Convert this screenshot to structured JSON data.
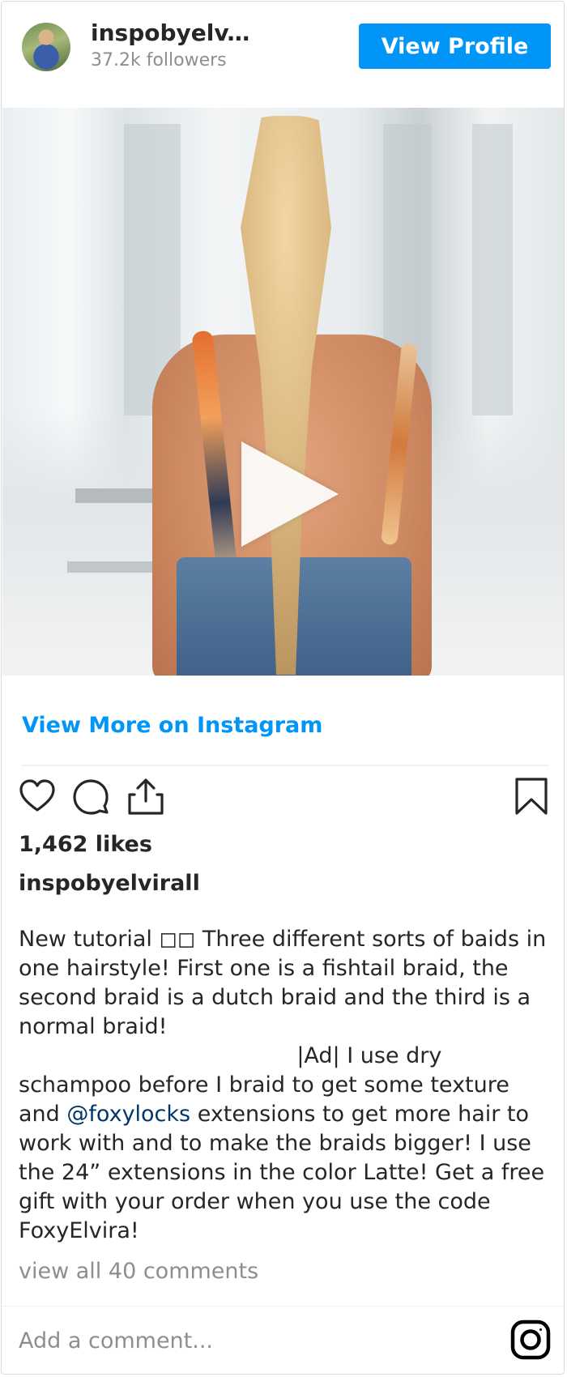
{
  "header": {
    "username": "inspobyelv...",
    "followers": "37.2k followers",
    "view_profile_label": "View Profile"
  },
  "media": {
    "type": "video",
    "play_icon": "play-icon"
  },
  "view_more_label": "View More on Instagram",
  "actions": {
    "like_icon": "heart-icon",
    "comment_icon": "comment-icon",
    "share_icon": "share-icon",
    "save_icon": "bookmark-icon"
  },
  "post": {
    "likes": "1,462 likes",
    "caption_username": "inspobyelvirall",
    "caption_part1": "New tutorial ◻◻ Three different sorts of baids in one hairstyle! First one is a fishtail braid, the second braid is a dutch braid and the third is a normal braid!\n                                        |Ad| I use dry schampoo before I braid to get some texture and ",
    "caption_mention": "@foxylocks",
    "caption_part2": " extensions to get more hair to work with and to make the braids bigger! I use the 24” extensions in the color Latte! Get a free gift with your order when you use the code FoxyElvira!",
    "view_comments": "view all 40 comments"
  },
  "comment_bar": {
    "placeholder": "Add a comment...",
    "logo_icon": "instagram-logo-icon"
  },
  "colors": {
    "accent": "#0095f6",
    "mention": "#00376b",
    "muted": "#8e8e8e",
    "text": "#262626"
  }
}
